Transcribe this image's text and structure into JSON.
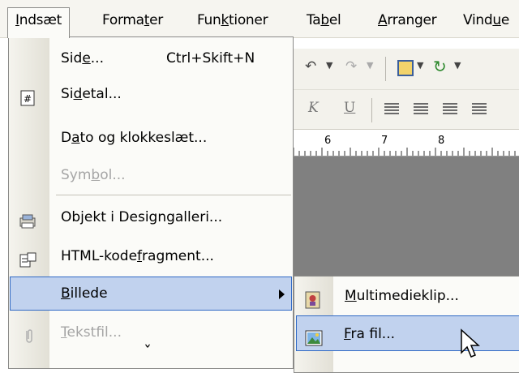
{
  "menubar": {
    "items": [
      {
        "pre": "",
        "key": "I",
        "post": "ndsæt"
      },
      {
        "pre": "Forma",
        "key": "t",
        "post": "er"
      },
      {
        "pre": "Fun",
        "key": "k",
        "post": "tioner"
      },
      {
        "pre": "Ta",
        "key": "b",
        "post": "el"
      },
      {
        "pre": "",
        "key": "A",
        "post": "rranger"
      },
      {
        "pre": "Vind",
        "key": "u",
        "post": "e"
      }
    ]
  },
  "insert_menu": {
    "items": [
      {
        "pre": "Sid",
        "key": "e",
        "post": "...",
        "shortcut": "Ctrl+Skift+N",
        "icon": "none",
        "state": "enabled"
      },
      {
        "pre": "Si",
        "key": "d",
        "post": "etal...",
        "shortcut": "",
        "icon": "page-number-icon",
        "state": "enabled"
      },
      {
        "pre": "D",
        "key": "a",
        "post": "to og klokkeslæt...",
        "shortcut": "",
        "icon": "none",
        "state": "enabled"
      },
      {
        "pre": "Sym",
        "key": "b",
        "post": "ol...",
        "shortcut": "",
        "icon": "none",
        "state": "disabled"
      },
      {
        "pre": "Ob",
        "key": "j",
        "post": "ekt i Designgalleri...",
        "shortcut": "",
        "icon": "design-gallery-icon",
        "state": "enabled"
      },
      {
        "pre": "HTML-kode",
        "key": "f",
        "post": "ragment...",
        "shortcut": "",
        "icon": "html-fragment-icon",
        "state": "enabled"
      },
      {
        "pre": "",
        "key": "B",
        "post": "illede",
        "shortcut": "",
        "icon": "none",
        "state": "highlighted",
        "submenu": true
      },
      {
        "pre": "",
        "key": "T",
        "post": "ekstfil...",
        "shortcut": "",
        "icon": "paperclip-icon",
        "state": "disabled"
      }
    ],
    "more_arrow": "ˇ"
  },
  "picture_submenu": {
    "items": [
      {
        "pre": "",
        "key": "M",
        "post": "ultimedieklip...",
        "icon": "clip-art-icon",
        "state": "enabled"
      },
      {
        "pre": "",
        "key": "F",
        "post": "ra fil...",
        "icon": "picture-from-file-icon",
        "state": "highlighted"
      }
    ]
  },
  "toolbar": {
    "format_b": "K",
    "format_u": "U",
    "ruler_marks": [
      "6",
      "7",
      "8"
    ]
  },
  "colors": {
    "highlight_bg": "#c1d2ee",
    "highlight_border": "#316ac5",
    "menu_bg": "#fbfbf8",
    "canvas": "#808080"
  }
}
